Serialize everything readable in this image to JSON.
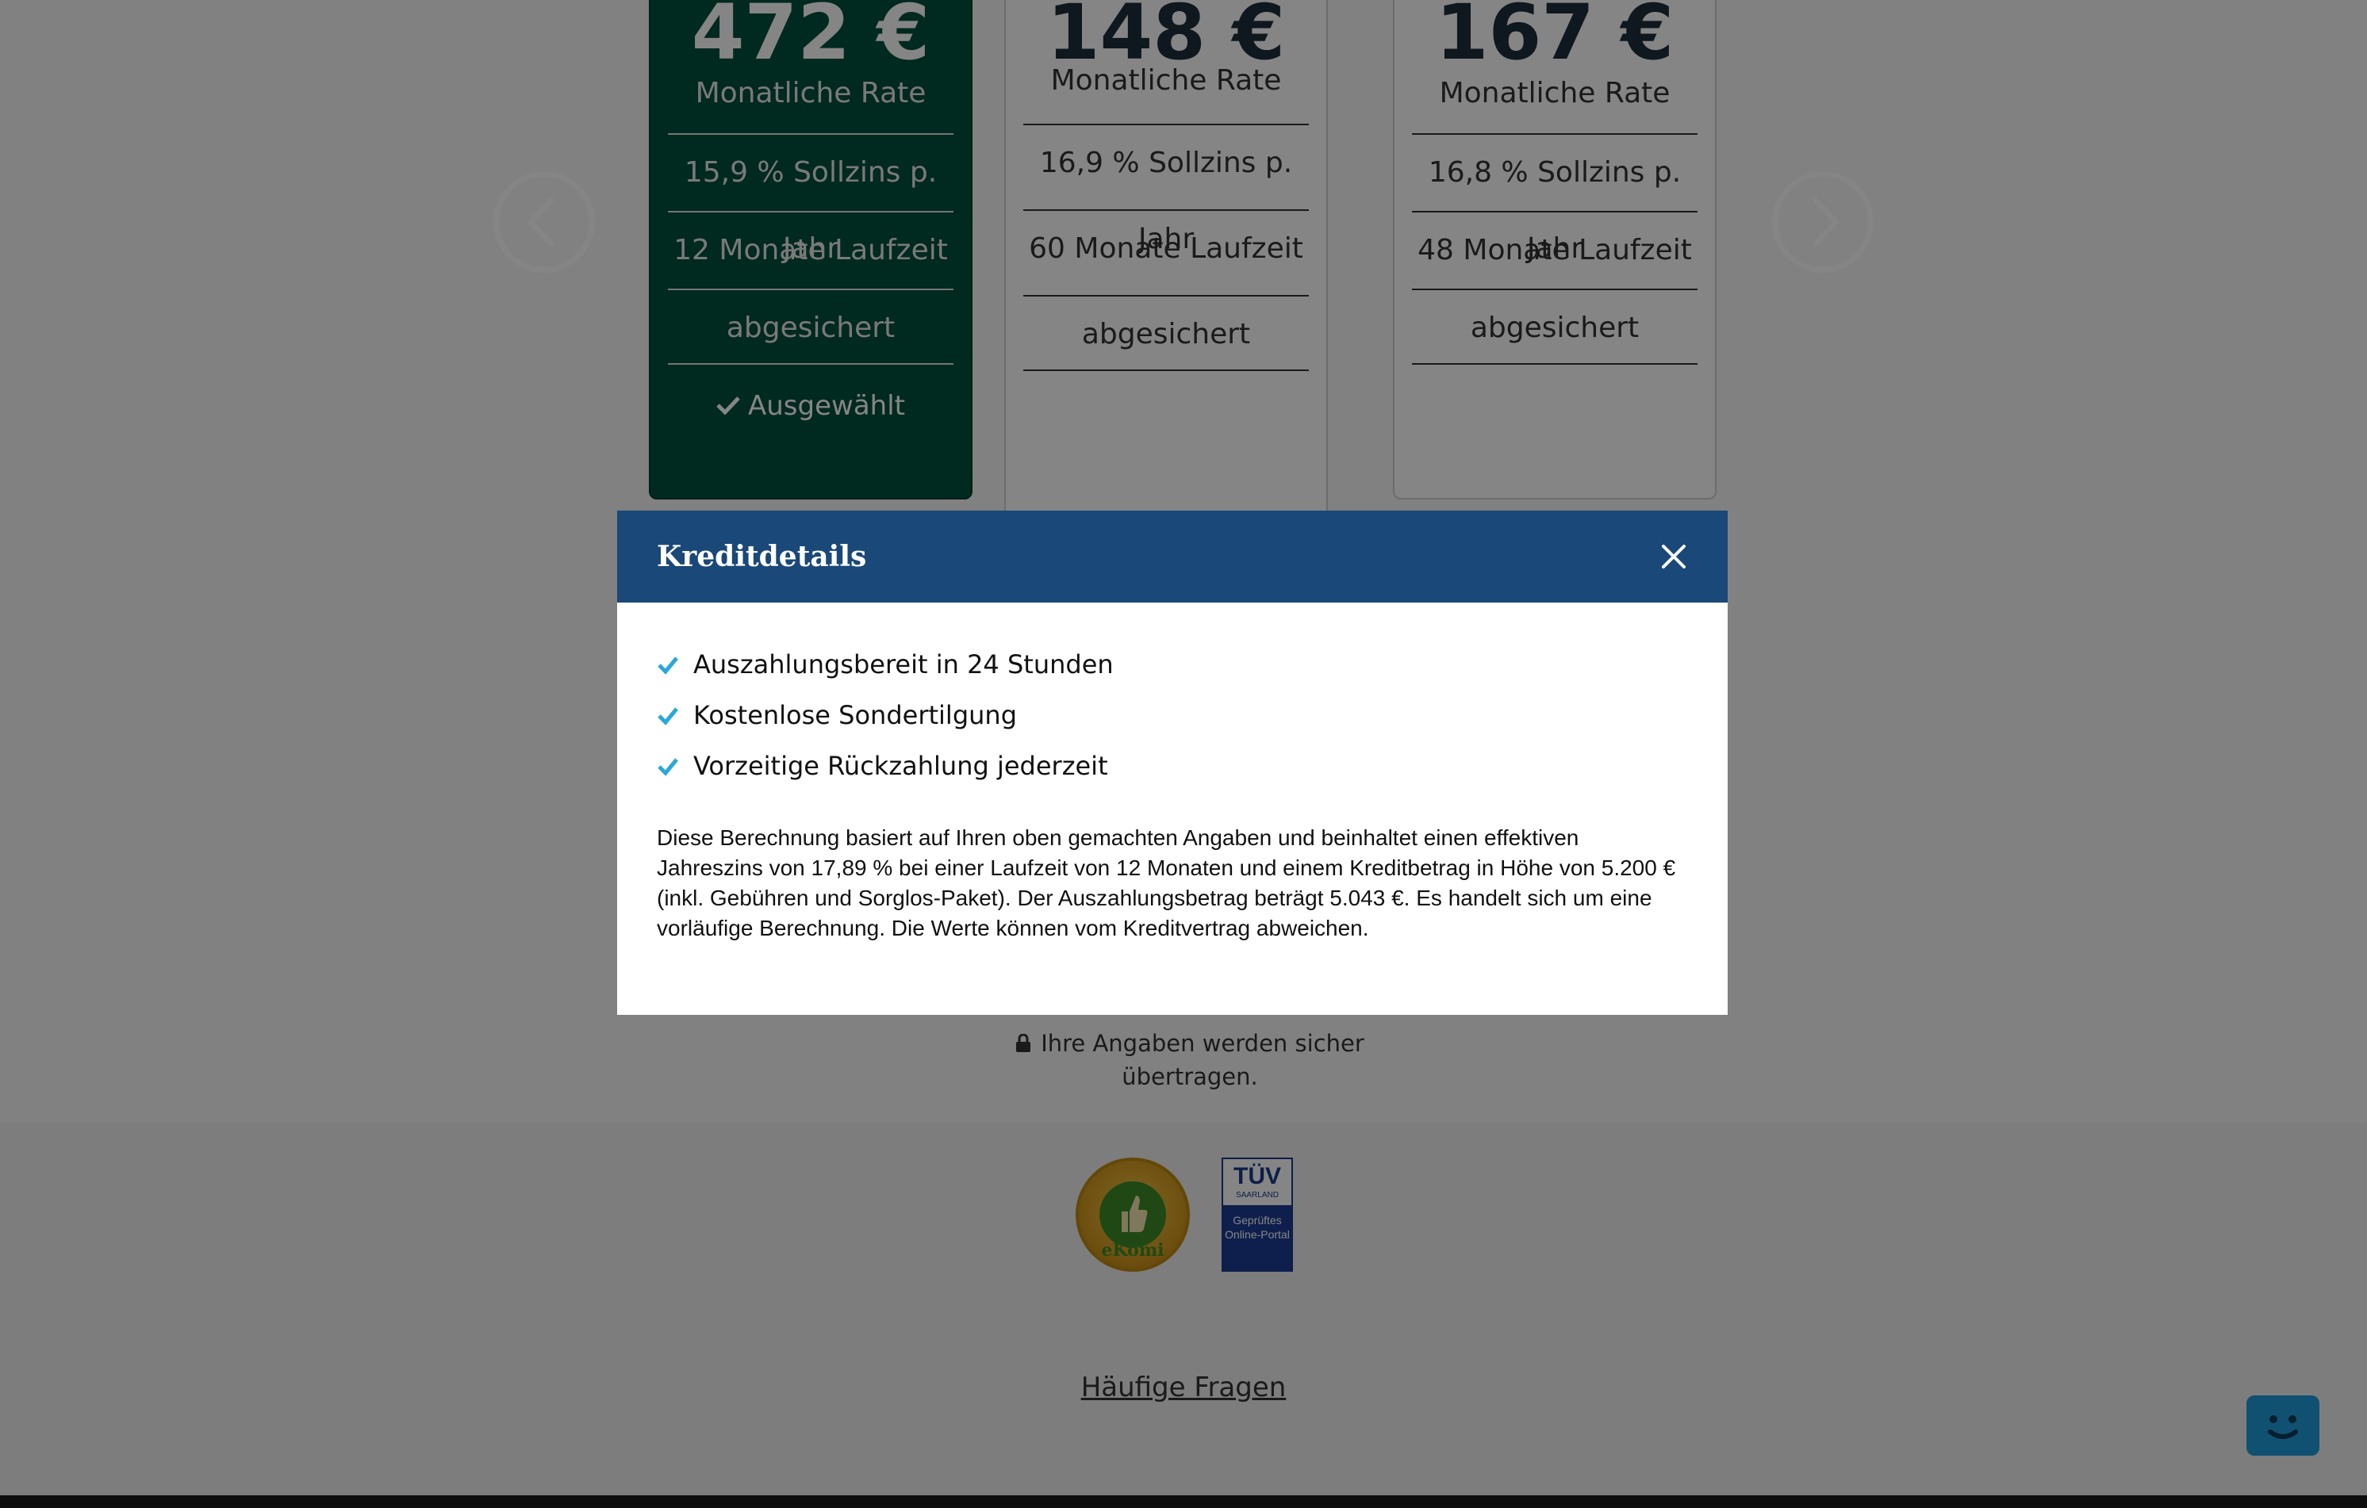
{
  "offers": [
    {
      "price": "472 €",
      "rate_label": "Monatliche Rate",
      "interest": "15,9 % Sollzins p. Jahr",
      "term": "12 Monate Laufzeit",
      "insurance": "abgesichert",
      "selected_label": "Ausgewählt"
    },
    {
      "price": "148 €",
      "rate_label": "Monatliche Rate",
      "interest": "16,9 % Sollzins p. Jahr",
      "term": "60 Monate Laufzeit",
      "insurance": "abgesichert"
    },
    {
      "price": "167 €",
      "rate_label": "Monatliche Rate",
      "interest": "16,8 % Sollzins p. Jahr",
      "term": "48 Monate Laufzeit",
      "insurance": "abgesichert"
    }
  ],
  "secure_note": "Ihre Angaben werden sicher übertragen.",
  "badges": {
    "ekomi_text": "eKomi",
    "tuv_title": "TÜV",
    "tuv_sub": "SAARLAND",
    "tuv_text": "Geprüftes Online-Portal"
  },
  "footer": {
    "faq_label": "Häufige Fragen"
  },
  "modal": {
    "title": "Kreditdetails",
    "features": [
      "Auszahlungsbereit in 24 Stunden",
      "Kostenlose Sondertilgung",
      "Vorzeitige Rückzahlung jederzeit"
    ],
    "description": "Diese Berechnung basiert auf Ihren oben gemachten Angaben und beinhaltet einen effektiven Jahreszins von 17,89 % bei einer Laufzeit von 12 Monaten und einem Kreditbetrag in Höhe von 5.200 € (inkl. Gebühren und Sorglos-Paket). Der Auszahlungsbetrag beträgt 5.043 €. Es handelt sich um eine vorläufige Berechnung. Die Werte können vom Kreditvertrag abweichen."
  },
  "icons": {
    "check": "check-icon",
    "close": "close-icon",
    "lock": "lock-icon",
    "arrow_left": "chevron-left-icon",
    "arrow_right": "chevron-right-icon",
    "chat": "chat-bot-icon"
  },
  "colors": {
    "modal_header": "#1a4878",
    "check_accent": "#29a8d9",
    "selected_card": "#00503c",
    "chat_button": "#1f9bd8"
  }
}
